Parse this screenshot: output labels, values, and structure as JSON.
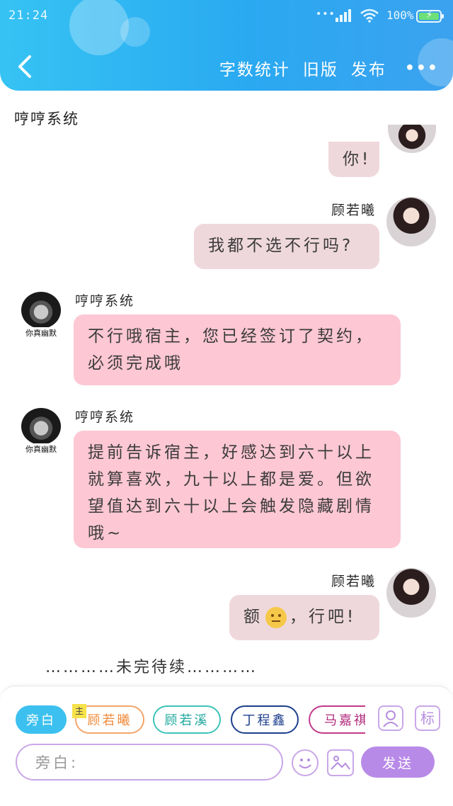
{
  "status_bar": {
    "time": "21:24",
    "signal_dots": "•••",
    "battery_percent": "100%",
    "battery_level": 1.0,
    "charging": true
  },
  "header": {
    "actions": [
      "字数统计",
      "旧版",
      "发布"
    ],
    "more": "•••",
    "color": "#2aa9f1"
  },
  "story": {
    "title": "哼哼系统"
  },
  "messages": [
    {
      "side": "right",
      "text": "你!",
      "partial": true
    },
    {
      "side": "right",
      "name": "顾若曦",
      "text": "我都不选不行吗?"
    },
    {
      "side": "left",
      "name": "哼哼系统",
      "text": "不行哦宿主，您已经签订了契约，必须完成哦"
    },
    {
      "side": "left",
      "name": "哼哼系统",
      "text": "提前告诉宿主，好感达到六十以上就算喜欢，九十以上都是爱。但欲望值达到六十以上会触发隐藏剧情哦~"
    },
    {
      "side": "right",
      "name": "顾若曦",
      "text_before": "额",
      "text_after": "，行吧!"
    }
  ],
  "meme_caption": "你真幽默",
  "to_be_continued": "…………未完待续…………",
  "composer": {
    "role_chips": [
      "旁白",
      "顾若曦",
      "顾若溪",
      "丁程鑫",
      "马嘉祺"
    ],
    "chip_tag": "主",
    "mark_button": "标",
    "input_placeholder": "旁白:",
    "send_label": "发送",
    "accent": "#b88ae8"
  }
}
